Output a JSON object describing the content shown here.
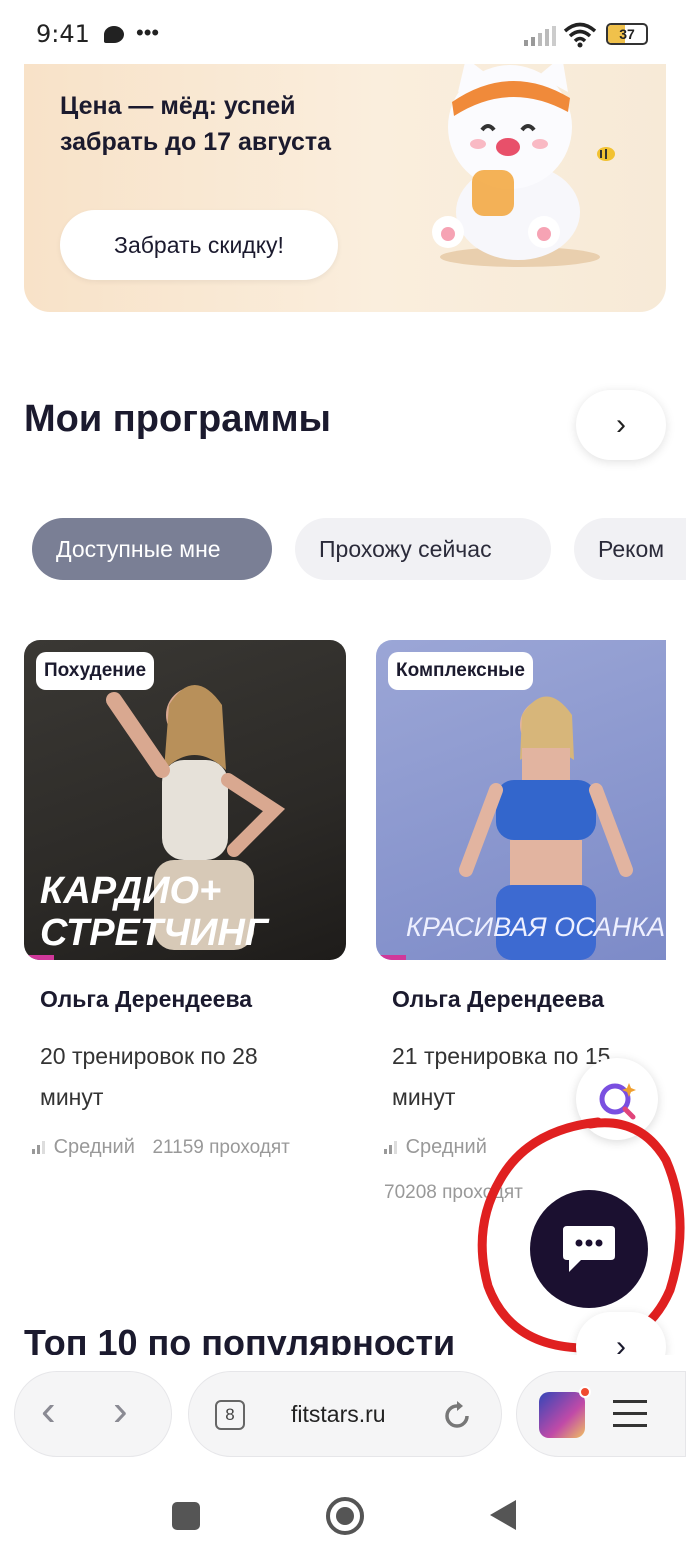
{
  "status_bar": {
    "time": "9:41",
    "battery": "37"
  },
  "promo": {
    "text": "Цена — мёд: успей забрать до 17 августа",
    "button": "Забрать скидку!"
  },
  "my_programs": {
    "title": "Мои программы",
    "chips": [
      {
        "label": "Доступные мне",
        "selected": true
      },
      {
        "label": "Прохожу сейчас",
        "selected": false
      },
      {
        "label": "Реком",
        "selected": false
      }
    ],
    "cards": [
      {
        "tag": "Похудение",
        "overlay": "КАРДИО+\nСТРЕТЧИНГ",
        "author": "Ольга Дерендеева",
        "desc": "20 тренировок по 28 минут",
        "level": "Средний",
        "count": "21159 проходят"
      },
      {
        "tag": "Комплексные",
        "overlay": "КРАСИВАЯ ОСАНКА",
        "author": "Ольга Дерендеева",
        "desc": "21 тренировка по 15 минут",
        "level": "Средний",
        "count": "70208 проходят"
      }
    ]
  },
  "top10": {
    "title": "Топ 10 по популярности"
  },
  "browser": {
    "tab_count": "8",
    "url": "fitstars.ru"
  },
  "colors": {
    "accent_dark": "#1b1030",
    "chip_selected": "#7a7f95",
    "annotation": "#e02020"
  }
}
